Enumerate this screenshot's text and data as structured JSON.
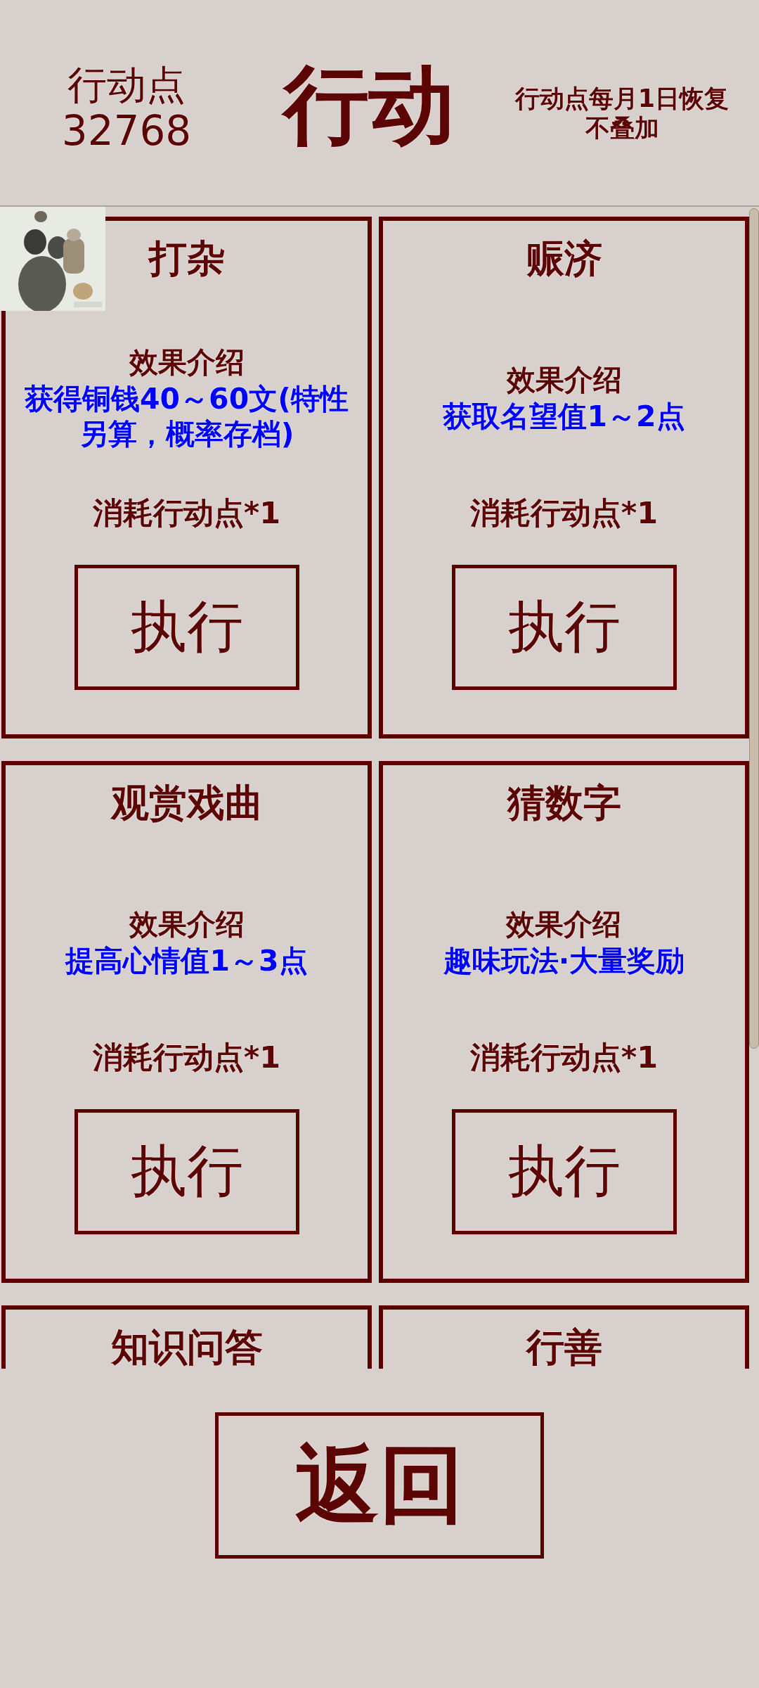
{
  "header": {
    "points_label": "行动点",
    "points_value": "32768",
    "title": "行动",
    "note_lines": [
      "行动点每月1日恢复",
      "不叠加"
    ]
  },
  "actions": [
    {
      "title": "打杂",
      "effect_label": "效果介绍",
      "effect": "获得铜钱40～60文(特性另算，概率存档)",
      "cost": "消耗行动点*1",
      "button": "执行"
    },
    {
      "title": "赈济",
      "effect_label": "效果介绍",
      "effect": "获取名望值1～2点",
      "cost": "消耗行动点*1",
      "button": "执行"
    },
    {
      "title": "观赏戏曲",
      "effect_label": "效果介绍",
      "effect": "提高心情值1～3点",
      "cost": "消耗行动点*1",
      "button": "执行"
    },
    {
      "title": "猜数字",
      "effect_label": "效果介绍",
      "effect": "趣味玩法·大量奖励",
      "cost": "消耗行动点*1",
      "button": "执行"
    },
    {
      "title": "知识问答"
    },
    {
      "title": "行善"
    }
  ],
  "back_button": "返回"
}
